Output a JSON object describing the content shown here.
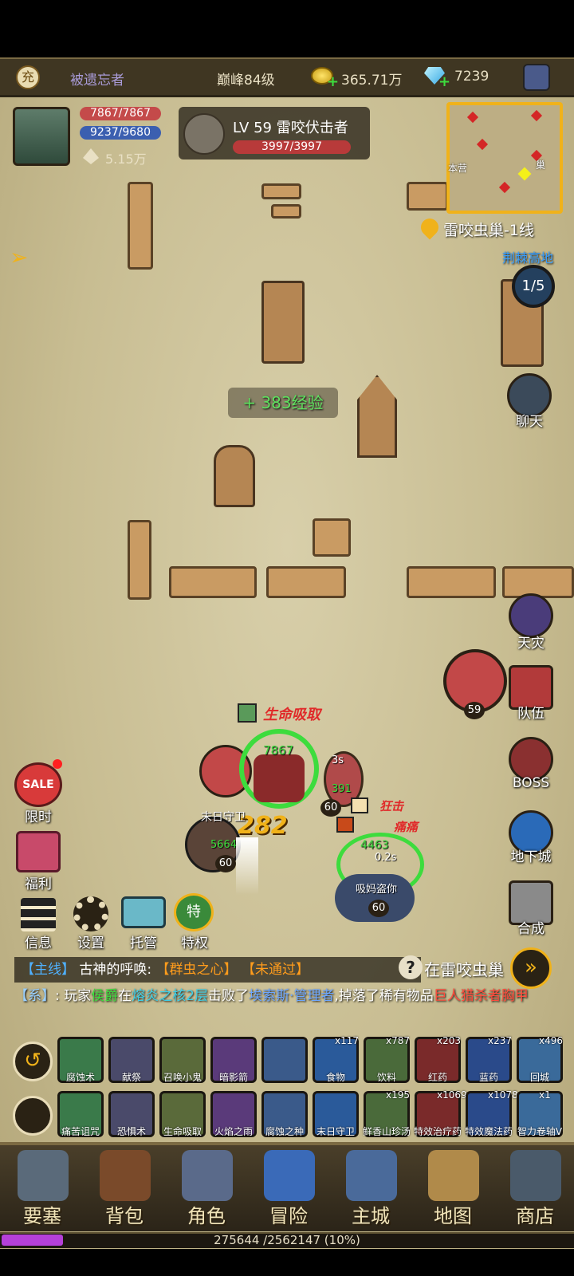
{
  "top_bar": {
    "recharge_icon": "充",
    "player_name": "被遗忘者",
    "peak_level": "巅峰84级",
    "gold": "365.71万",
    "diamonds": "7239",
    "menu_icon": "wizard-hat-icon"
  },
  "player": {
    "hp": "7867/7867",
    "mp": "9237/9680",
    "power": "5.15万"
  },
  "target": {
    "title": "LV 59 雷咬伏击者",
    "hp": "3997/3997"
  },
  "minimap": {
    "label_left": "本营",
    "label_right": "巢",
    "location": "雷咬虫巢-1线",
    "next_area": "荆棘高地",
    "wave": "1/5"
  },
  "chat_button": "聊天",
  "exp_popup": "+ 383经验",
  "right_menu": {
    "disaster": "天灾",
    "team": "队伍",
    "boss": "BOSS",
    "dungeon": "地下城",
    "craft": "合成",
    "enemy_level": "59"
  },
  "left_menu": {
    "limited": "限时",
    "sale_text": "SALE",
    "welfare": "福利"
  },
  "utility_buttons": {
    "info": "信息",
    "settings": "设置",
    "auto": "托管",
    "privilege": "特权",
    "privilege_badge": "特"
  },
  "battle": {
    "skill_callout": "生命吸取",
    "player_hp_overhead": "7867",
    "damage_number": "282",
    "ally_name": "末日守卫",
    "ally_hp": "5664",
    "ally_level": "60",
    "player_level": "60",
    "pet_hp": "4463",
    "pet_timer": "0.2s",
    "pet_level": "60",
    "pet_name": "吸妈盗你",
    "buff_a": "狂击",
    "buff_b": "痛痛",
    "timer_b": "3s",
    "hp_b": "391"
  },
  "quest": {
    "tag": "【主线】",
    "name": "古神的呼唤:",
    "target": "【群虫之心】",
    "status": "【未通过】",
    "side_text": "在雷咬虫巢"
  },
  "system_msg": {
    "tag": "【系】",
    "prefix": ": 玩家",
    "player": "侯爵",
    "mid1": "在",
    "place": "熔炎之核2层",
    "mid2": "击败了",
    "boss": "埃索斯·管理者",
    "mid3": ",掉落了稀有物品",
    "item": "巨人猎杀者胸甲"
  },
  "skill_row_1": [
    {
      "label": "腐蚀术",
      "count": ""
    },
    {
      "label": "献祭",
      "count": ""
    },
    {
      "label": "召唤小鬼",
      "count": ""
    },
    {
      "label": "暗影箭",
      "count": ""
    },
    {
      "label": "",
      "count": ""
    },
    {
      "label": "食物",
      "count": "x117"
    },
    {
      "label": "饮料",
      "count": "x787"
    },
    {
      "label": "红药",
      "count": "x203"
    },
    {
      "label": "蓝药",
      "count": "x237"
    },
    {
      "label": "回城",
      "count": "x496"
    }
  ],
  "skill_row_2": [
    {
      "label": "痛苦诅咒",
      "count": ""
    },
    {
      "label": "恐惧术",
      "count": ""
    },
    {
      "label": "生命吸取",
      "count": ""
    },
    {
      "label": "火焰之雨",
      "count": ""
    },
    {
      "label": "腐蚀之种",
      "count": ""
    },
    {
      "label": "末日守卫",
      "count": ""
    },
    {
      "label": "鲜香山珍汤",
      "count": "x195"
    },
    {
      "label": "特效治疗药",
      "count": "x1069"
    },
    {
      "label": "特效魔法药",
      "count": "x1078"
    },
    {
      "label": "智力卷轴V",
      "count": "x1"
    }
  ],
  "bottom_nav": [
    {
      "label": "要塞",
      "icon": "fortress-icon"
    },
    {
      "label": "背包",
      "icon": "backpack-icon"
    },
    {
      "label": "角色",
      "icon": "helmet-icon"
    },
    {
      "label": "冒险",
      "icon": "portal-icon"
    },
    {
      "label": "主城",
      "icon": "castle-icon"
    },
    {
      "label": "地图",
      "icon": "scroll-map-icon"
    },
    {
      "label": "商店",
      "icon": "shop-icon"
    }
  ],
  "exp": {
    "text": "275644 /2562147 (10%)",
    "fraction": 0.1076
  },
  "colors": {
    "gold_accent": "#f0b21a",
    "quest_tag": "#4fb1ff",
    "quest_target": "#ff9c1c",
    "player_green": "#3ddc3d",
    "place_cyan": "#3fd0e8",
    "item_red": "#ff4d3d",
    "boss_blue": "#6fa8ff",
    "exp_purple": "#b540d8"
  }
}
